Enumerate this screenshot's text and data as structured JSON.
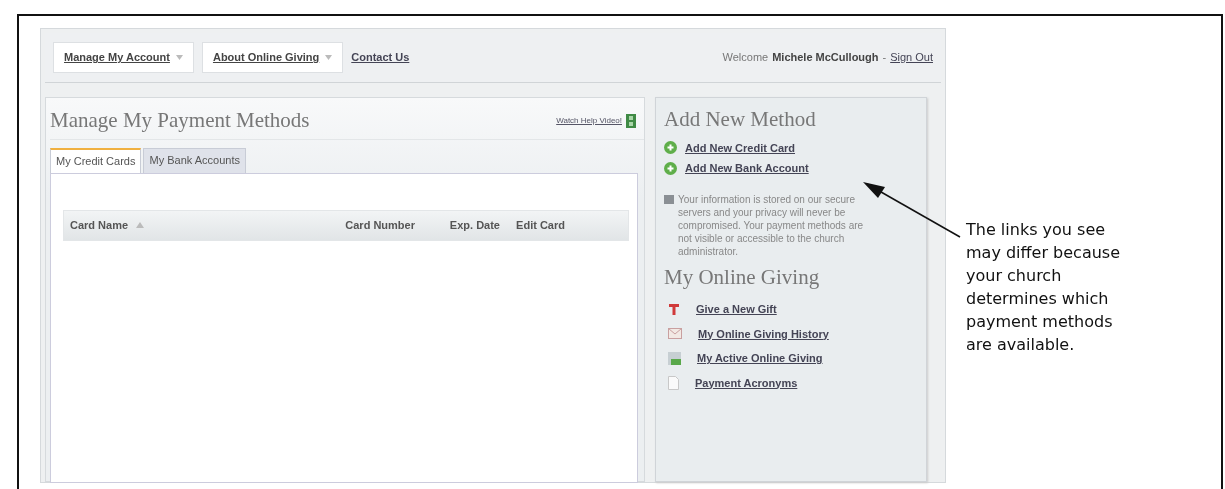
{
  "nav": {
    "menus": [
      {
        "label": "Manage My Account",
        "kind": "dropdown"
      },
      {
        "label": "About Online Giving",
        "kind": "dropdown"
      },
      {
        "label": "Contact Us",
        "kind": "link"
      }
    ],
    "welcome": {
      "prefix": "Welcome",
      "user": "Michele McCullough",
      "separator": "-",
      "link": "Sign Out"
    }
  },
  "main": {
    "title": "Manage My Payment Methods",
    "help_link": "Watch Help Video!",
    "tabs": [
      {
        "label": "My Credit Cards",
        "selected": true
      },
      {
        "label": "My Bank Accounts",
        "selected": false
      }
    ],
    "table": {
      "columns": [
        {
          "label": "Card Name",
          "sorted": true
        },
        {
          "label": "Card Number",
          "sorted": false
        },
        {
          "label": "Exp. Date",
          "sorted": false
        },
        {
          "label": "Edit Card",
          "sorted": false
        }
      ]
    }
  },
  "sidebar": {
    "add_title": "Add New Method",
    "add_links": [
      {
        "label": "Add New Credit Card"
      },
      {
        "label": "Add New Bank Account"
      }
    ],
    "note": "Your information is stored on our secure servers and your privacy will never be compromised. Your payment methods are not visible or accessible to the church administrator.",
    "giving_title": "My Online Giving",
    "giving_links": [
      {
        "label": "Give a New Gift",
        "kind": "gift"
      },
      {
        "label": "My Online Giving History",
        "kind": "history"
      },
      {
        "label": "My Active Online Giving",
        "kind": "active"
      },
      {
        "label": "Payment Acronyms",
        "kind": "document"
      }
    ]
  },
  "annotation": {
    "text": "The links you see may differ because your church determines which payment methods are available."
  }
}
